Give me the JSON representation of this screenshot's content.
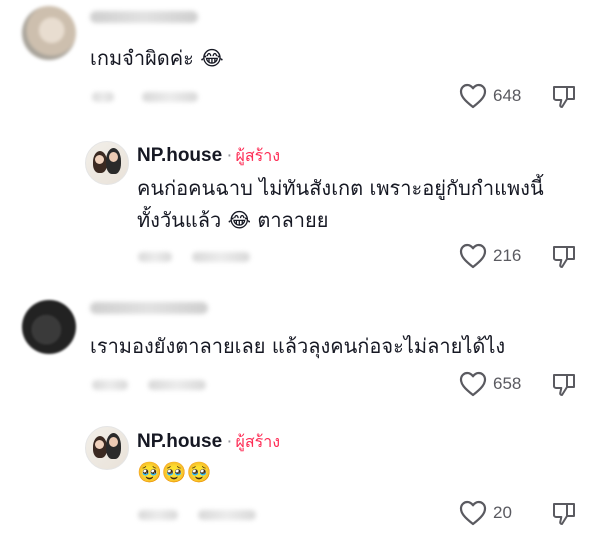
{
  "comments": [
    {
      "username": "",
      "text": "เกมจำผิดค่ะ",
      "emoji": "😂",
      "likes": "648"
    },
    {
      "username": "NP.house",
      "separator": "·",
      "badge": "ผู้สร้าง",
      "text_line1": "คนก่อคนฉาบ ไม่ทันสังเกต เพราะอยู่กับกำแพงนี้",
      "text_line2": "ทั้งวันแล้ว",
      "emoji": "😂",
      "text_line2_tail": "ตาลายย",
      "likes": "216"
    },
    {
      "username": "",
      "text": "เรามองยังตาลายเลย แล้วลุงคนก่อจะไม่ลายได้ไง",
      "likes": "658"
    },
    {
      "username": "NP.house",
      "separator": "·",
      "badge": "ผู้สร้าง",
      "emoji": "🥹🥹🥹",
      "likes": "20"
    }
  ],
  "icons": {
    "like": "heart-outline-icon",
    "dislike": "thumbs-down-outline-icon"
  },
  "colors": {
    "creator_badge": "#fe2c55",
    "text": "#161823",
    "secondary": "#5a5a60"
  }
}
